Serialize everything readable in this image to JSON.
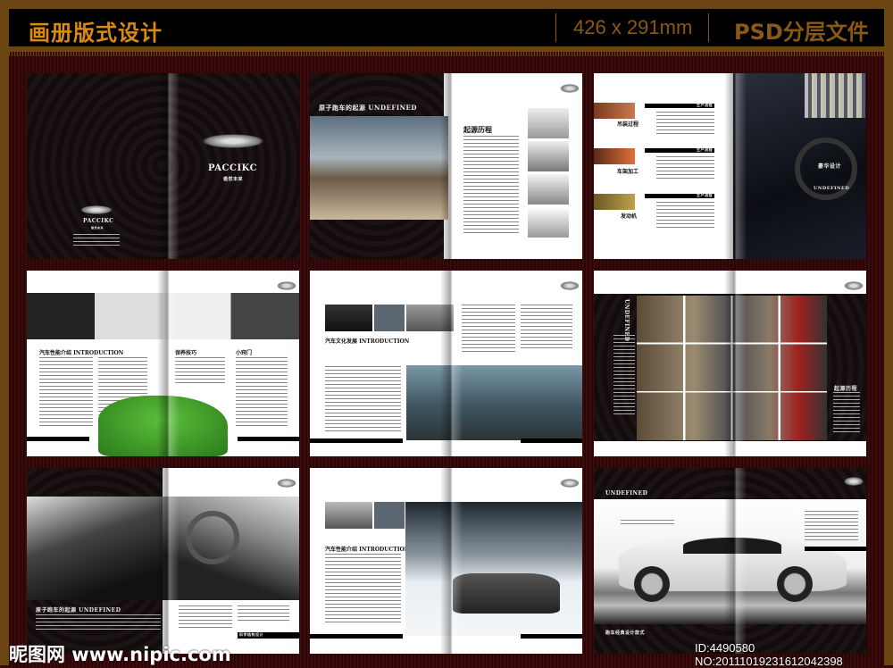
{
  "header": {
    "title": "画册版式设计",
    "size": "426 x 291mm",
    "format": "PSD分层文件"
  },
  "colors": {
    "accent": "#d98a12",
    "frame": "#6b4512",
    "background": "#3b0b0b"
  },
  "spreads": {
    "cover": {
      "brand": "PACCIKC",
      "slogan": "傲然未来",
      "back_brand": "PACCIKC",
      "back_slogan": "傲然未来"
    },
    "s2": {
      "banner": "原子跑车的起源  UNDEFINED",
      "heading": "起源历程"
    },
    "s3": {
      "tag": "生产流程",
      "items": [
        "吊装过程",
        "车架加工",
        "发动机"
      ],
      "overlay1": "豪华设计",
      "overlay2": "UNDEFINED"
    },
    "s4": {
      "heading1": "汽车性能介绍 INTRODUCTION",
      "heading2": "保养技巧",
      "heading3": "小窍门"
    },
    "s5": {
      "heading": "汽车文化发展 INTRODUCTION"
    },
    "s6": {
      "vertical": "UNDEFINED",
      "heading": "起源历程"
    },
    "s7": {
      "banner": "原子跑车的起源  UNDEFINED",
      "footer": "科学结构设计"
    },
    "s8": {
      "heading": "汽车性能介绍 INTRODUCTION"
    },
    "s9": {
      "banner": "UNDEFINED",
      "footer": "跑车经典设计款式"
    }
  },
  "watermark": {
    "site": "昵图网 www.nipic.com",
    "id": "ID:4490580 NO:20111019231612042398"
  }
}
